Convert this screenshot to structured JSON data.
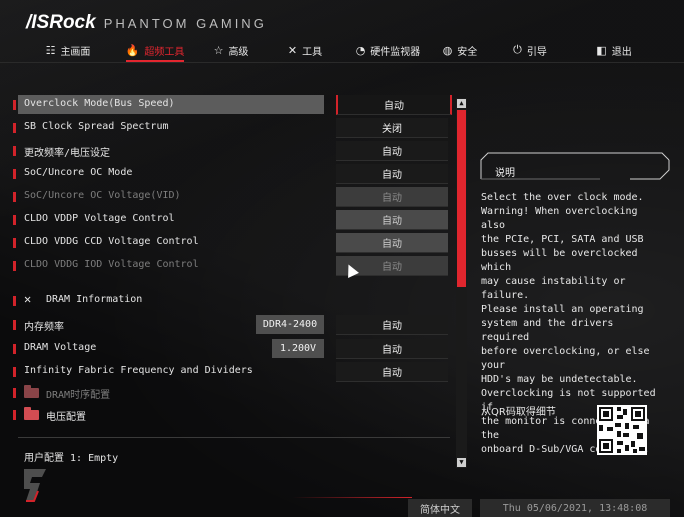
{
  "brand": {
    "logo": "/ISRock",
    "sub": "PHANTOM GAMING"
  },
  "nav": [
    {
      "icon": "☷",
      "label": "主画面"
    },
    {
      "icon": "🔥",
      "label": "超频工具"
    },
    {
      "icon": "☆",
      "label": "高级"
    },
    {
      "icon": "✕",
      "label": "工具"
    },
    {
      "icon": "◔",
      "label": "硬件监视器"
    },
    {
      "icon": "◍",
      "label": "安全"
    },
    {
      "icon": "⏻",
      "label": "引导"
    },
    {
      "icon": "◧",
      "label": "退出"
    }
  ],
  "settings": [
    {
      "label": "Overclock Mode(Bus Speed)",
      "value": "自动"
    },
    {
      "label": "SB Clock Spread Spectrum",
      "value": "关闭"
    },
    {
      "label": "更改频率/电压设定",
      "value": "自动"
    },
    {
      "label": "SoC/Uncore OC Mode",
      "value": "自动"
    },
    {
      "label": "SoC/Uncore OC Voltage(VID)",
      "value": "自动"
    },
    {
      "label": "CLDO VDDP Voltage Control",
      "value": "自动"
    },
    {
      "label": "CLDO VDDG CCD Voltage Control",
      "value": "自动"
    },
    {
      "label": "CLDO VDDG IOD Voltage Control",
      "value": "自动"
    }
  ],
  "dram_section": {
    "icon": "✕",
    "label": "DRAM Information"
  },
  "dram_settings": [
    {
      "label": "内存频率",
      "info": "DDR4-2400",
      "value": "自动"
    },
    {
      "label": "DRAM Voltage",
      "info": "1.200V",
      "value": "自动"
    },
    {
      "label": "Infinity Fabric Frequency and Dividers",
      "value": "自动"
    }
  ],
  "submenus": [
    {
      "label": "DRAM时序配置"
    },
    {
      "label": "电压配置"
    }
  ],
  "profile": "用户配置 1: Empty",
  "help": {
    "title": "说明",
    "text": "Select the over clock mode.\nWarning! When overclocking also\nthe PCIe, PCI, SATA and USB\nbusses will be overclocked which\nmay cause instability or failure.\nPlease install an operating\nsystem and the drivers required\nbefore overclocking, or else your\nHDD's may be undetectable.\nOverclocking is not supported if\nthe monitor is connected via the\nonboard D-Sub/VGA connector.",
    "qr_label": "从QR码取得细节"
  },
  "footer": {
    "language": "简体中文",
    "datetime": "Thu 05/06/2021, 13:48:08"
  },
  "colors": {
    "accent": "#d2232a",
    "tab_active": "#e3262f",
    "background": "#0b0b0c"
  }
}
